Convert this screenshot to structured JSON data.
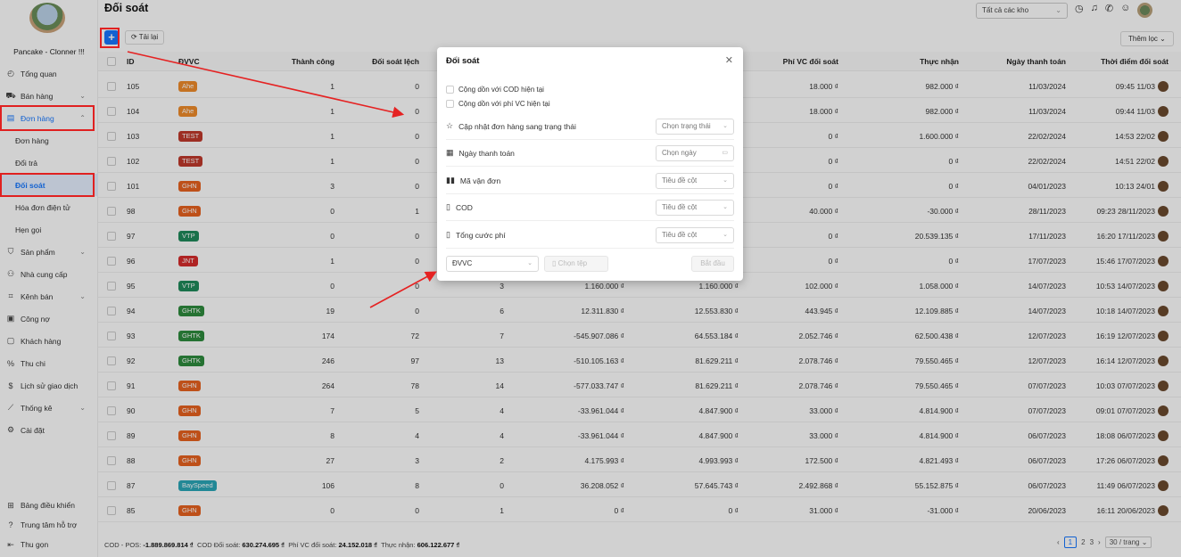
{
  "sidebar": {
    "shop_name": "Pancake - Clonner !!!",
    "items": [
      {
        "label": "Tổng quan",
        "icon": "dashboard-icon"
      },
      {
        "label": "Bán hàng",
        "icon": "cart-icon"
      },
      {
        "label": "Đơn hàng",
        "icon": "order-icon"
      },
      {
        "label": "Đơn hàng"
      },
      {
        "label": "Đổi trả"
      },
      {
        "label": "Đối soát"
      },
      {
        "label": "Hóa đơn điện tử"
      },
      {
        "label": "Hẹn gọi"
      },
      {
        "label": "Sản phẩm",
        "icon": "product-icon"
      },
      {
        "label": "Nhà cung cấp",
        "icon": "supplier-icon"
      },
      {
        "label": "Kênh bán",
        "icon": "channel-icon"
      },
      {
        "label": "Công nợ",
        "icon": "debt-icon"
      },
      {
        "label": "Khách hàng",
        "icon": "customer-icon"
      },
      {
        "label": "Thu chi",
        "icon": "percent-icon"
      },
      {
        "label": "Lịch sử giao dịch",
        "icon": "history-icon"
      },
      {
        "label": "Thống kê",
        "icon": "chart-icon"
      },
      {
        "label": "Cài đặt",
        "icon": "settings-icon"
      }
    ],
    "bottom": [
      {
        "label": "Bảng điều khiển"
      },
      {
        "label": "Trung tâm hỗ trợ"
      },
      {
        "label": "Thu gọn"
      }
    ]
  },
  "header": {
    "title": "Đối soát",
    "warehouse": "Tất cả các kho"
  },
  "toolbar": {
    "add": "+",
    "reload": "Tải lại",
    "more_filter": "Thêm lọc"
  },
  "table": {
    "columns": {
      "id": "ID",
      "dvvc": "ĐVVC",
      "tc": "Thành công",
      "dsl": "Đối soát lệch",
      "pvc": "Phí VC đối soát",
      "tn": "Thực nhận",
      "ntt": "Ngày thanh toán",
      "td": "Thời điểm đối soát"
    },
    "rows": [
      {
        "id": "105",
        "dv": "Ahe",
        "c": "#f08c2a",
        "tc": "1",
        "dsl": "0",
        "x1": "",
        "x2": "",
        "x3": "",
        "pvc": "18.000 ₫",
        "tn": "982.000 ₫",
        "ntt": "11/03/2024",
        "td": "09:45 11/03"
      },
      {
        "id": "104",
        "dv": "Ahe",
        "c": "#f08c2a",
        "tc": "1",
        "dsl": "0",
        "x1": "",
        "x2": "",
        "x3": "",
        "pvc": "18.000 ₫",
        "tn": "982.000 ₫",
        "ntt": "11/03/2024",
        "td": "09:44 11/03"
      },
      {
        "id": "103",
        "dv": "TEST",
        "c": "#c0392b",
        "tc": "1",
        "dsl": "0",
        "x1": "",
        "x2": "",
        "x3": "",
        "pvc": "0 ₫",
        "tn": "1.600.000 ₫",
        "ntt": "22/02/2024",
        "td": "14:53 22/02"
      },
      {
        "id": "102",
        "dv": "TEST",
        "c": "#c0392b",
        "tc": "1",
        "dsl": "0",
        "x1": "",
        "x2": "",
        "x3": "",
        "pvc": "0 ₫",
        "tn": "0 ₫",
        "ntt": "22/02/2024",
        "td": "14:51 22/02"
      },
      {
        "id": "101",
        "dv": "GHN",
        "c": "#e8621f",
        "tc": "3",
        "dsl": "0",
        "x1": "",
        "x2": "",
        "x3": "",
        "pvc": "0 ₫",
        "tn": "0 ₫",
        "ntt": "04/01/2023",
        "td": "10:13 24/01"
      },
      {
        "id": "98",
        "dv": "GHN",
        "c": "#e8621f",
        "tc": "0",
        "dsl": "1",
        "x1": "",
        "x2": "",
        "x3": "",
        "pvc": "40.000 ₫",
        "tn": "-30.000 ₫",
        "ntt": "28/11/2023",
        "td": "09:23 28/11/2023"
      },
      {
        "id": "97",
        "dv": "VTP",
        "c": "#1f8a5b",
        "tc": "0",
        "dsl": "0",
        "x1": "",
        "x2": "",
        "x3": "",
        "pvc": "0 ₫",
        "tn": "20.539.135 ₫",
        "ntt": "17/11/2023",
        "td": "16:20 17/11/2023"
      },
      {
        "id": "96",
        "dv": "JNT",
        "c": "#d62b2b",
        "tc": "1",
        "dsl": "0",
        "x1": "",
        "x2": "",
        "x3": "",
        "pvc": "0 ₫",
        "tn": "0 ₫",
        "ntt": "17/07/2023",
        "td": "15:46 17/07/2023"
      },
      {
        "id": "95",
        "dv": "VTP",
        "c": "#1f8a5b",
        "tc": "0",
        "dsl": "0",
        "x1": "3",
        "x2": "1.160.000 ₫",
        "x3": "1.160.000 ₫",
        "pvc": "102.000 ₫",
        "tn": "1.058.000 ₫",
        "ntt": "14/07/2023",
        "td": "10:53 14/07/2023"
      },
      {
        "id": "94",
        "dv": "GHTK",
        "c": "#2e8b3d",
        "tc": "19",
        "dsl": "0",
        "x1": "6",
        "x2": "12.311.830 ₫",
        "x3": "12.553.830 ₫",
        "pvc": "443.945 ₫",
        "tn": "12.109.885 ₫",
        "ntt": "14/07/2023",
        "td": "10:18 14/07/2023"
      },
      {
        "id": "93",
        "dv": "GHTK",
        "c": "#2e8b3d",
        "tc": "174",
        "dsl": "72",
        "x1": "7",
        "x2": "-545.907.086 ₫",
        "x3": "64.553.184 ₫",
        "pvc": "2.052.746 ₫",
        "tn": "62.500.438 ₫",
        "ntt": "12/07/2023",
        "td": "16:19 12/07/2023"
      },
      {
        "id": "92",
        "dv": "GHTK",
        "c": "#2e8b3d",
        "tc": "246",
        "dsl": "97",
        "x1": "13",
        "x2": "-510.105.163 ₫",
        "x3": "81.629.211 ₫",
        "pvc": "2.078.746 ₫",
        "tn": "79.550.465 ₫",
        "ntt": "12/07/2023",
        "td": "16:14 12/07/2023"
      },
      {
        "id": "91",
        "dv": "GHN",
        "c": "#e8621f",
        "tc": "264",
        "dsl": "78",
        "x1": "14",
        "x2": "-577.033.747 ₫",
        "x3": "81.629.211 ₫",
        "pvc": "2.078.746 ₫",
        "tn": "79.550.465 ₫",
        "ntt": "07/07/2023",
        "td": "10:03 07/07/2023"
      },
      {
        "id": "90",
        "dv": "GHN",
        "c": "#e8621f",
        "tc": "7",
        "dsl": "5",
        "x1": "4",
        "x2": "-33.961.044 ₫",
        "x3": "4.847.900 ₫",
        "pvc": "33.000 ₫",
        "tn": "4.814.900 ₫",
        "ntt": "07/07/2023",
        "td": "09:01 07/07/2023"
      },
      {
        "id": "89",
        "dv": "GHN",
        "c": "#e8621f",
        "tc": "8",
        "dsl": "4",
        "x1": "4",
        "x2": "-33.961.044 ₫",
        "x3": "4.847.900 ₫",
        "pvc": "33.000 ₫",
        "tn": "4.814.900 ₫",
        "ntt": "06/07/2023",
        "td": "18:08 06/07/2023"
      },
      {
        "id": "88",
        "dv": "GHN",
        "c": "#e8621f",
        "tc": "27",
        "dsl": "3",
        "x1": "2",
        "x2": "4.175.993 ₫",
        "x3": "4.993.993 ₫",
        "pvc": "172.500 ₫",
        "tn": "4.821.493 ₫",
        "ntt": "06/07/2023",
        "td": "17:26 06/07/2023"
      },
      {
        "id": "87",
        "dv": "BaySpeed",
        "c": "#2aa6b8",
        "tc": "106",
        "dsl": "8",
        "x1": "0",
        "x2": "36.208.052 ₫",
        "x3": "57.645.743 ₫",
        "pvc": "2.492.868 ₫",
        "tn": "55.152.875 ₫",
        "ntt": "06/07/2023",
        "td": "11:49 06/07/2023"
      },
      {
        "id": "85",
        "dv": "GHN",
        "c": "#e8621f",
        "tc": "0",
        "dsl": "0",
        "x1": "1",
        "x2": "0 ₫",
        "x3": "0 ₫",
        "pvc": "31.000 ₫",
        "tn": "-31.000 ₫",
        "ntt": "20/06/2023",
        "td": "16:11 20/06/2023"
      }
    ]
  },
  "footer": {
    "cod_label": "COD - POS:",
    "cod_val": "-1.889.869.814 ₫",
    "ds_label": "COD Đối soát:",
    "ds_val": "630.274.695 ₫",
    "pvc_label": "Phí VC đối soát:",
    "pvc_val": "24.152.018 ₫",
    "tn_label": "Thực nhận:",
    "tn_val": "606.122.677 ₫",
    "pages": [
      "1",
      "2",
      "3"
    ],
    "page_size": "30 / trang"
  },
  "modal": {
    "title": "Đối soát",
    "chk1": "Cộng dồn với COD hiện tại",
    "chk2": "Cộng dồn với phí VC hiện tại",
    "rows": [
      {
        "label": "Cập nhật đơn hàng sang trạng thái",
        "select": "Chọn trạng thái",
        "icon": "star-icon"
      },
      {
        "label": "Ngày thanh toán",
        "select": "Chọn ngày",
        "icon": "calendar-icon"
      },
      {
        "label": "Mã vận đơn",
        "select": "Tiêu đề cột",
        "icon": "barcode-icon"
      },
      {
        "label": "COD",
        "select": "Tiêu đề cột",
        "icon": "file-icon"
      },
      {
        "label": "Tổng cước phí",
        "select": "Tiêu đề cột",
        "icon": "file-icon"
      }
    ],
    "dvvc": "ĐVVC",
    "file": "Chọn tệp",
    "start": "Bắt đầu"
  }
}
